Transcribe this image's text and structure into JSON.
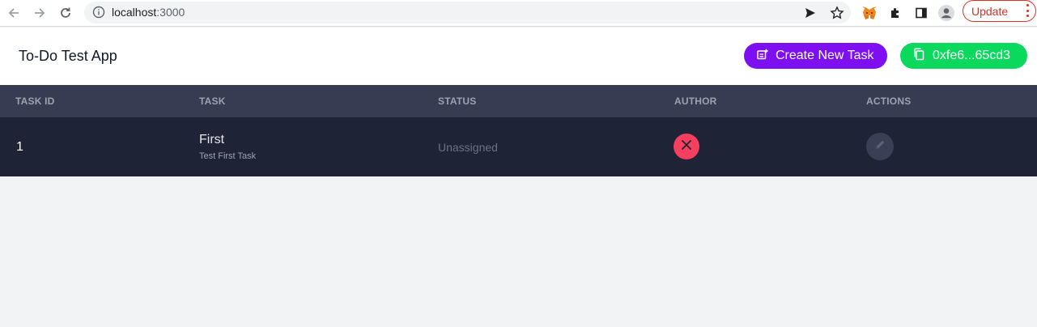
{
  "browser": {
    "url_host": "localhost",
    "url_port": ":3000",
    "update_label": "Update",
    "icons": [
      "back-icon",
      "forward-icon",
      "reload-icon",
      "info-icon",
      "share-icon",
      "star-icon",
      "metamask-icon",
      "extensions-icon",
      "sidepanel-icon",
      "profile-icon",
      "more-icon"
    ]
  },
  "header": {
    "title": "To-Do Test App",
    "create_label": "Create New Task",
    "wallet_label": "0xfe6...65cd3"
  },
  "table": {
    "columns": [
      "TASK ID",
      "TASK",
      "STATUS",
      "AUTHOR",
      "ACTIONS"
    ],
    "rows": [
      {
        "id": "1",
        "title": "First",
        "description": "Test First Task",
        "status": "Unassigned"
      }
    ]
  },
  "colors": {
    "create_button": "#7e0ff0",
    "wallet_button": "#0bd95d",
    "author_badge": "#f43f5e",
    "table_header": "#363c52",
    "table_row": "#1f2336"
  }
}
